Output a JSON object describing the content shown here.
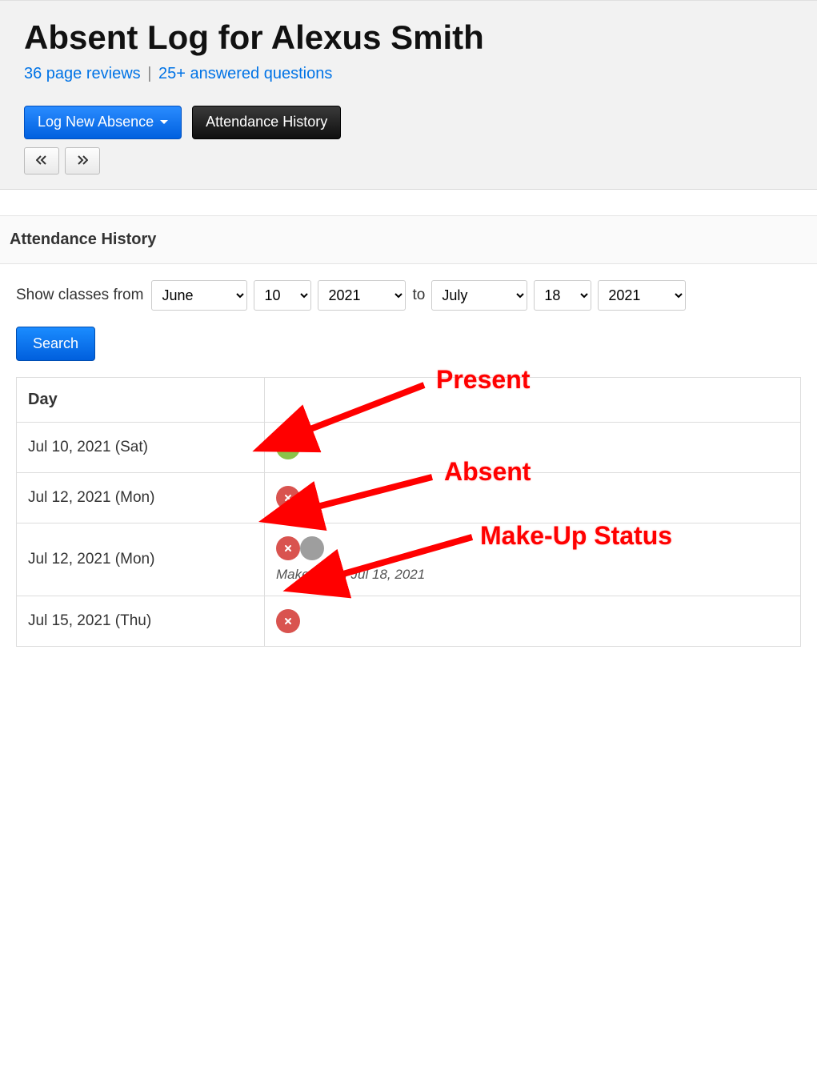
{
  "header": {
    "title": "Absent Log for Alexus Smith",
    "reviews_link": "36 page reviews",
    "questions_link": "25+ answered questions",
    "sep": " | "
  },
  "toolbar": {
    "log_new_absence": "Log New Absence",
    "attendance_history": "Attendance History",
    "prev_icon": "prev-icon",
    "next_icon": "next-icon"
  },
  "section": {
    "title": "Attendance History"
  },
  "filter": {
    "show_label": "Show classes from",
    "to_label": "to",
    "from_month": "June",
    "from_day": "10",
    "from_year": "2021",
    "to_month": "July",
    "to_day": "18",
    "to_year": "2021",
    "search_label": "Search"
  },
  "table": {
    "col_day": "Day",
    "rows": [
      {
        "day": "Jul 10, 2021 (Sat)",
        "status": "present"
      },
      {
        "day": "Jul 12, 2021 (Mon)",
        "status": "absent"
      },
      {
        "day": "Jul 12, 2021 (Mon)",
        "status": "absent_makeup",
        "note": "Make up on Jul 18, 2021"
      },
      {
        "day": "Jul 15, 2021 (Thu)",
        "status": "absent"
      }
    ]
  },
  "annotations": {
    "present": "Present",
    "absent": "Absent",
    "makeup": "Make-Up Status"
  }
}
